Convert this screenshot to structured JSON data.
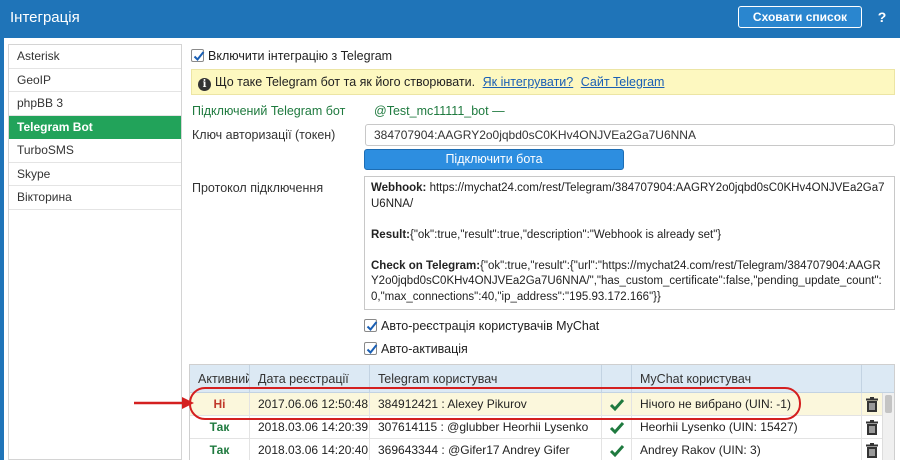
{
  "window": {
    "title": "Інтеграція",
    "hide_list_label": "Сховати список",
    "help_label": "?"
  },
  "sidebar": {
    "items": [
      {
        "label": "Asterisk",
        "active": false
      },
      {
        "label": "GeoIP",
        "active": false
      },
      {
        "label": "phpBB 3",
        "active": false
      },
      {
        "label": "Telegram Bot",
        "active": true
      },
      {
        "label": "TurboSMS",
        "active": false
      },
      {
        "label": "Skype",
        "active": false
      },
      {
        "label": "Вікторина",
        "active": false
      }
    ]
  },
  "main": {
    "enable_integration": {
      "label": "Включити інтеграцію з Telegram",
      "checked": true
    },
    "info": {
      "text": "Що таке Telegram бот та як його створювати.",
      "link_integrate": "Як інтегрувати?",
      "link_site": "Сайт Telegram"
    },
    "connected_bot": {
      "label": "Підключений Telegram бот",
      "value": "@Test_mc11111_bot —"
    },
    "token": {
      "label": "Ключ авторизації (токен)",
      "value": "384707904:AAGRY2o0jqbd0sC0KHv4ONJVEa2Ga7U6NNA"
    },
    "connect_button": "Підключити бота",
    "protocol": {
      "label": "Протокол підключення",
      "webhook_key": "Webhook:",
      "webhook_value": " https://mychat24.com/rest/Telegram/384707904:AAGRY2o0jqbd0sC0KHv4ONJVEa2Ga7U6NNA/",
      "result_key": "Result:",
      "result_value": "{\"ok\":true,\"result\":true,\"description\":\"Webhook is already set\"}",
      "check_key": "Check on Telegram:",
      "check_value": "{\"ok\":true,\"result\":{\"url\":\"https://mychat24.com/rest/Telegram/384707904:AAGRY2o0jqbd0sC0KHv4ONJVEa2Ga7U6NNA/\",\"has_custom_certificate\":false,\"pending_update_count\":0,\"max_connections\":40,\"ip_address\":\"195.93.172.166\"}}"
    },
    "auto_register": {
      "label": "Авто-реєстрація користувачів MyChat",
      "checked": true
    },
    "auto_activate": {
      "label": "Авто-активація",
      "checked": true
    }
  },
  "table": {
    "headers": [
      "Активний",
      "Дата реєстрації",
      "Telegram користувач",
      "",
      "MyChat користувач",
      ""
    ],
    "rows": [
      {
        "active": "Ні",
        "active_state": "no",
        "date": "2017.06.06 12:50:48",
        "telegram_user": "384912421 : Alexey Pikurov",
        "mychat_user": "Нічого не вибрано (UIN: -1)",
        "selected": true
      },
      {
        "active": "Так",
        "active_state": "yes",
        "date": "2018.03.06 14:20:39",
        "telegram_user": "307614115 : @glubber Heorhii Lysenko",
        "mychat_user": "Heorhii Lysenko (UIN: 15427)",
        "selected": false
      },
      {
        "active": "Так",
        "active_state": "yes",
        "date": "2018.03.06 14:20:40",
        "telegram_user": "369643344 : @Gifer17 Andrey Gifer",
        "mychat_user": "Andrey Rakov (UIN: 3)",
        "selected": false
      }
    ]
  },
  "colors": {
    "titlebar": "#1f74b8",
    "active_nav": "#22a35a",
    "info_bar": "#fdf8c0",
    "highlight": "#d42020",
    "check": "#1f7a3f"
  },
  "icons": {
    "check": "checkmark-icon",
    "trash": "trash-icon",
    "info": "info-icon"
  }
}
